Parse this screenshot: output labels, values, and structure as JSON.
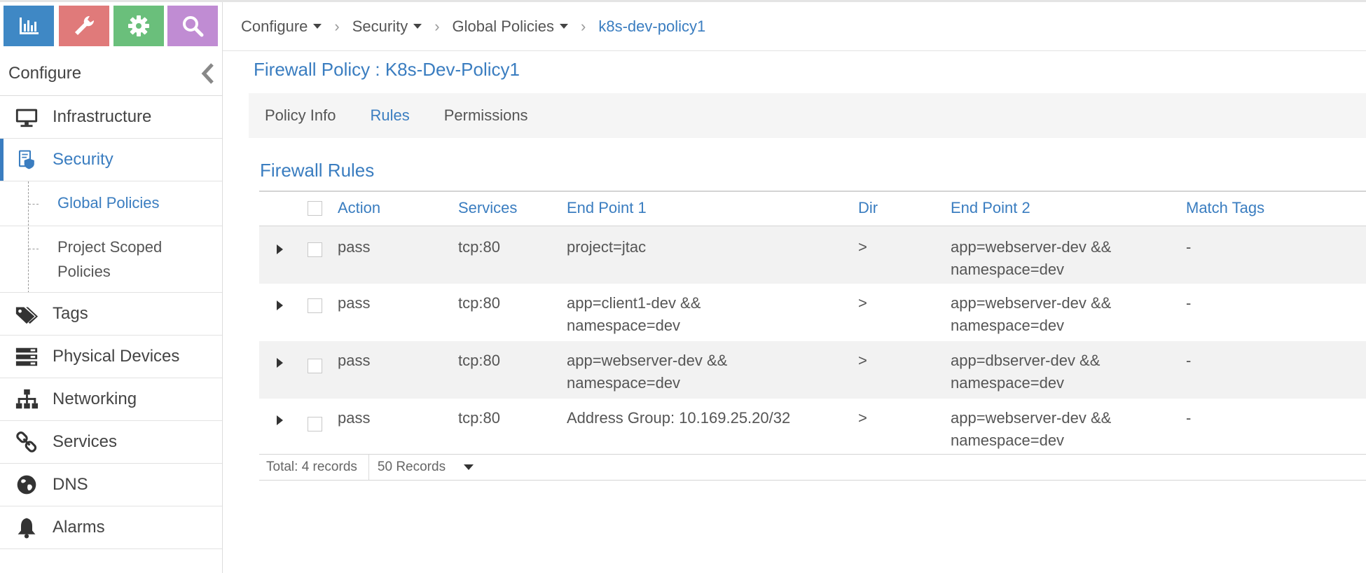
{
  "sidebar": {
    "title": "Configure",
    "top_buttons": [
      {
        "icon": "bar-chart-icon",
        "color": "#3f88c5"
      },
      {
        "icon": "wrench-icon",
        "color": "#e07a7a"
      },
      {
        "icon": "gear-icon",
        "color": "#6abf7b"
      },
      {
        "icon": "search-icon",
        "color": "#c08cd3"
      }
    ],
    "items": [
      {
        "label": "Infrastructure",
        "icon": "monitor-icon"
      },
      {
        "label": "Security",
        "icon": "shield-document-icon"
      },
      {
        "label": "Tags",
        "icon": "tags-icon"
      },
      {
        "label": "Physical Devices",
        "icon": "server-icon"
      },
      {
        "label": "Networking",
        "icon": "network-icon"
      },
      {
        "label": "Services",
        "icon": "link-icon"
      },
      {
        "label": "DNS",
        "icon": "globe-icon"
      },
      {
        "label": "Alarms",
        "icon": "bell-icon"
      }
    ],
    "security_subitems": [
      "Global Policies",
      "Project Scoped Policies"
    ]
  },
  "breadcrumb": [
    "Configure",
    "Security",
    "Global Policies",
    "k8s-dev-policy1"
  ],
  "page_title": "Firewall Policy : K8s-Dev-Policy1",
  "tabs": [
    "Policy Info",
    "Rules",
    "Permissions"
  ],
  "section_title": "Firewall Rules",
  "table": {
    "columns": [
      "Action",
      "Services",
      "End Point 1",
      "Dir",
      "End Point 2",
      "Match Tags"
    ],
    "rows": [
      {
        "action": "pass",
        "services": "tcp:80",
        "ep1": [
          "project=jtac"
        ],
        "dir": ">",
        "ep2": [
          "app=webserver-dev &&",
          "namespace=dev"
        ],
        "tags": "-"
      },
      {
        "action": "pass",
        "services": "tcp:80",
        "ep1": [
          "app=client1-dev &&",
          "namespace=dev"
        ],
        "dir": ">",
        "ep2": [
          "app=webserver-dev &&",
          "namespace=dev"
        ],
        "tags": "-"
      },
      {
        "action": "pass",
        "services": "tcp:80",
        "ep1": [
          "app=webserver-dev &&",
          "namespace=dev"
        ],
        "dir": ">",
        "ep2": [
          "app=dbserver-dev &&",
          "namespace=dev"
        ],
        "tags": "-"
      },
      {
        "action": "pass",
        "services": "tcp:80",
        "ep1": [
          "Address Group: 10.169.25.20/32"
        ],
        "dir": ">",
        "ep2": [
          "app=webserver-dev &&",
          "namespace=dev"
        ],
        "tags": "-"
      }
    ]
  },
  "footer": {
    "total": "Total: 4 records",
    "page_size": "50 Records"
  },
  "colors": {
    "accent": "#3a7dc0",
    "row_stripe": "#f2f2f2"
  }
}
